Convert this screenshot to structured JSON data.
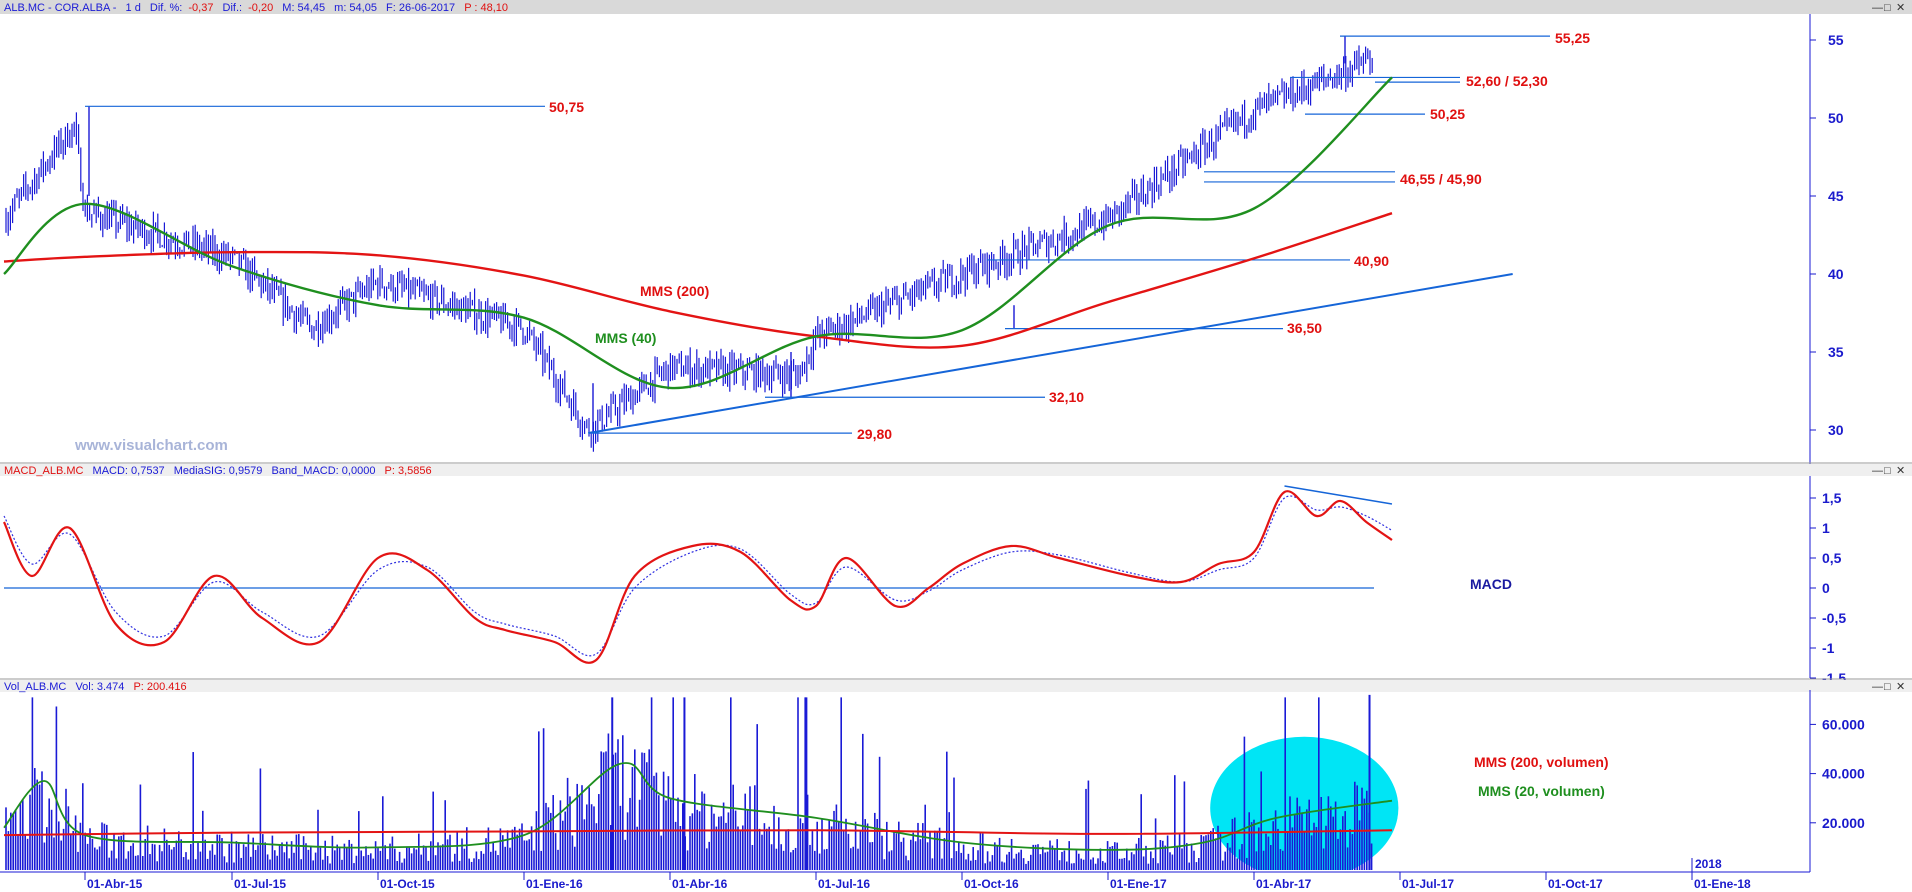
{
  "price_panel": {
    "header": {
      "symbol": "ALB.MC - COR.ALBA -",
      "timeframe": "1 d",
      "dif_pct_label": "Dif. %:",
      "dif_pct": "-0,37",
      "dif_label": "Dif.:",
      "dif": "-0,20",
      "max": "M: 54,45",
      "min": "m: 54,05",
      "date": "F: 26-06-2017",
      "p": "P : 48,10"
    },
    "watermark": "www.visualchart.com",
    "annotations": {
      "mms200": "MMS (200)",
      "mms40": "MMS (40)",
      "l5525": "55,25",
      "l5260": "52,60 / 52,30",
      "l5025a": "50,25",
      "l5075": "50,75",
      "l4655": "46,55 / 45,90",
      "l4090": "40,90",
      "l3650": "36,50",
      "l3210": "32,10",
      "l2980": "29,80"
    }
  },
  "macd_panel": {
    "header": {
      "name": "MACD_ALB.MC",
      "macd": "MACD: 0,7537",
      "signal": "MediaSIG: 0,9579",
      "band": "Band_MACD: 0,0000",
      "p": "P: 3,5856"
    },
    "label": "MACD"
  },
  "volume_panel": {
    "header": {
      "name": "Vol_ALB.MC",
      "vol": "Vol: 3.474",
      "p": "P: 200.416"
    },
    "labels": {
      "mms200": "MMS (200, volumen)",
      "mms20": "MMS (20, volumen)"
    }
  },
  "window_buttons": [
    "—",
    "□",
    "✕"
  ],
  "colors": {
    "bars": "#1a1ad6",
    "mms200": "#e31414",
    "mms40": "#1f8f1f",
    "trend": "#1565d8",
    "annot": "#e01010",
    "axis": "#1a1acc",
    "volume": "#1a1ad6",
    "highlight": "#00e5f5"
  },
  "chart_data": [
    {
      "type": "line",
      "title": "ALB.MC - COR.ALBA - 1 d",
      "x_ticks": [
        "01-Abr-15",
        "01-Jul-15",
        "01-Oct-15",
        "01-Ene-16",
        "01-Abr-16",
        "01-Jul-16",
        "01-Oct-16",
        "01-Ene-17",
        "01-Abr-17",
        "01-Jul-17",
        "01-Oct-17",
        "01-Ene-18"
      ],
      "extra_x_label": "2018",
      "y_ticks": [
        30,
        35,
        40,
        45,
        50,
        55
      ],
      "ylim": [
        28.2,
        57.6
      ],
      "series": [
        {
          "name": "MMS (200)",
          "x": [
            "2015-01-01",
            "2015-04-01",
            "2015-07-01",
            "2015-10-01",
            "2016-01-01",
            "2016-04-01",
            "2016-07-01",
            "2016-10-01",
            "2017-01-01",
            "2017-04-01",
            "2017-06-26"
          ],
          "values": [
            40.8,
            41.1,
            41.4,
            41.2,
            39.9,
            37.6,
            36.0,
            35.4,
            38.2,
            41.0,
            43.9
          ]
        },
        {
          "name": "MMS (40)",
          "x": [
            "2015-01-01",
            "2015-04-01",
            "2015-07-01",
            "2015-10-01",
            "2016-01-01",
            "2016-04-01",
            "2016-07-01",
            "2016-10-01",
            "2017-01-01",
            "2017-04-01",
            "2017-06-26"
          ],
          "values": [
            40.0,
            44.5,
            40.5,
            38.0,
            37.2,
            32.7,
            36.0,
            36.4,
            43.1,
            44.2,
            52.6
          ]
        },
        {
          "name": "Precio (cierre)",
          "x": [
            "2015-01-01",
            "2015-03-20",
            "2015-04-01",
            "2015-07-01",
            "2015-08-20",
            "2015-10-01",
            "2016-01-01",
            "2016-02-10",
            "2016-04-01",
            "2016-06-20",
            "2016-07-01",
            "2016-10-01",
            "2017-01-01",
            "2017-04-01",
            "2017-06-26"
          ],
          "values": [
            43.5,
            49.5,
            44.0,
            41.0,
            36.5,
            39.5,
            36.5,
            30.0,
            34.0,
            33.5,
            36.0,
            40.0,
            43.5,
            50.5,
            54.3
          ]
        }
      ],
      "horizontal_levels": [
        55.25,
        52.6,
        52.3,
        50.25,
        50.75,
        46.55,
        45.9,
        40.9,
        36.5,
        32.1,
        29.8
      ],
      "trendline": {
        "from": {
          "x": "2016-02-10",
          "y": 29.8
        },
        "to": {
          "x": "2017-09-10",
          "y": 40.0
        }
      }
    },
    {
      "type": "line",
      "title": "MACD_ALB.MC",
      "y_ticks": [
        -1.5,
        -1,
        -0.5,
        0,
        0.5,
        1,
        1.5
      ],
      "ylim": [
        -1.5,
        1.75
      ],
      "x": [
        "2015-01-01",
        "2015-02-01",
        "2015-03-15",
        "2015-04-20",
        "2015-05-20",
        "2015-06-20",
        "2015-07-20",
        "2015-08-25",
        "2015-10-01",
        "2015-11-01",
        "2015-12-01",
        "2015-12-20",
        "2016-01-20",
        "2016-02-15",
        "2016-03-10",
        "2016-04-15",
        "2016-05-15",
        "2016-06-15",
        "2016-07-01",
        "2016-07-20",
        "2016-08-20",
        "2016-09-10",
        "2016-10-01",
        "2016-11-01",
        "2016-12-01",
        "2017-01-15",
        "2017-02-15",
        "2017-03-10",
        "2017-04-01",
        "2017-04-20",
        "2017-05-10",
        "2017-05-25",
        "2017-06-10",
        "2017-06-26"
      ],
      "series": [
        {
          "name": "MACD",
          "values": [
            1.1,
            0.2,
            1.0,
            -0.6,
            -0.9,
            0.2,
            -0.5,
            -0.9,
            0.5,
            0.3,
            -0.5,
            -0.7,
            -0.9,
            -1.2,
            0.2,
            0.7,
            0.6,
            -0.2,
            -0.3,
            0.5,
            -0.3,
            0.0,
            0.4,
            0.7,
            0.5,
            0.2,
            0.1,
            0.4,
            0.6,
            1.6,
            1.2,
            1.45,
            1.1,
            0.8
          ]
        },
        {
          "name": "MediaSIG",
          "values": [
            1.2,
            0.4,
            0.9,
            -0.4,
            -0.8,
            0.1,
            -0.4,
            -0.8,
            0.3,
            0.35,
            -0.4,
            -0.6,
            -0.8,
            -1.1,
            0.0,
            0.6,
            0.65,
            -0.1,
            -0.25,
            0.35,
            -0.2,
            -0.05,
            0.3,
            0.6,
            0.55,
            0.25,
            0.1,
            0.3,
            0.5,
            1.5,
            1.3,
            1.35,
            1.2,
            0.96
          ]
        }
      ],
      "zero_line": 0
    },
    {
      "type": "bar",
      "title": "Vol_ALB.MC",
      "y_ticks": [
        20000,
        40000,
        60000
      ],
      "ylim": [
        0,
        74000
      ],
      "series": [
        {
          "name": "MMS (200, volumen)",
          "x": [
            "2015-01-01",
            "2015-07-01",
            "2016-01-01",
            "2016-07-01",
            "2017-01-01",
            "2017-06-26"
          ],
          "values": [
            15000,
            16000,
            16500,
            17000,
            15500,
            17000
          ]
        },
        {
          "name": "MMS (20, volumen)",
          "x": [
            "2015-01-01",
            "2015-02-15",
            "2015-04-01",
            "2015-07-01",
            "2015-10-01",
            "2016-01-01",
            "2016-03-01",
            "2016-04-01",
            "2016-07-01",
            "2016-10-01",
            "2017-01-01",
            "2017-03-01",
            "2017-04-15",
            "2017-06-26"
          ],
          "values": [
            18000,
            37000,
            15000,
            12000,
            10000,
            15000,
            44000,
            30000,
            22000,
            12000,
            9000,
            12000,
            22000,
            29000
          ]
        }
      ],
      "notable_peaks": [
        {
          "x": "2017-06-12",
          "value": 72000
        },
        {
          "x": "2016-02-25",
          "value": 71000
        },
        {
          "x": "2016-04-10",
          "value": 71000
        },
        {
          "x": "2016-06-25",
          "value": 71000
        }
      ]
    }
  ]
}
